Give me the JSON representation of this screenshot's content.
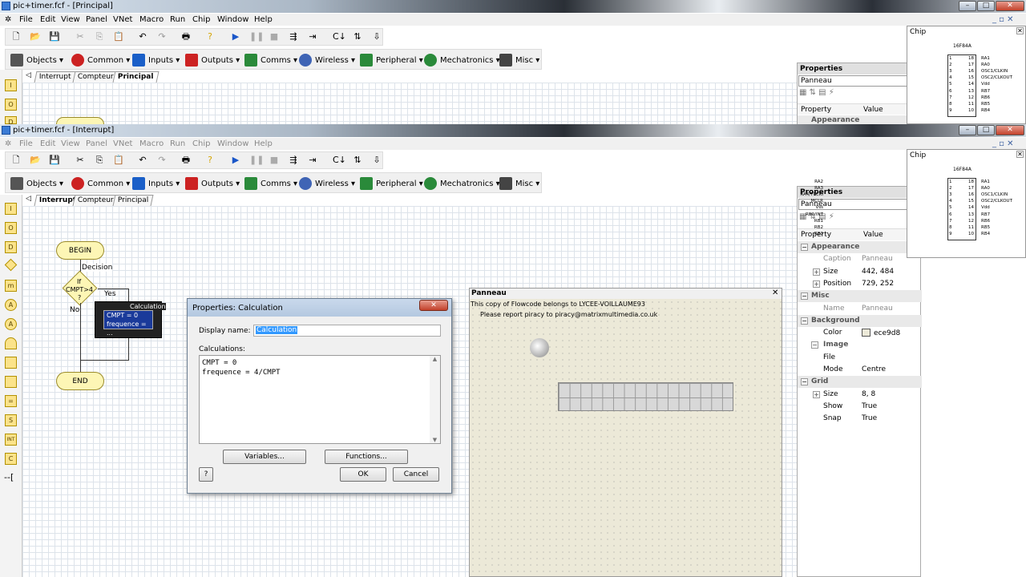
{
  "windows": [
    {
      "title": "pic+timer.fcf - [Principal]",
      "tabs": [
        "Interrupt",
        "Compteur",
        "Principal"
      ],
      "active_tab": "Principal"
    },
    {
      "title": "pic+timer.fcf - [Interrupt]",
      "tabs": [
        "Interrupt",
        "Compteur",
        "Principal"
      ],
      "active_tab": "Interrupt"
    }
  ],
  "menu": [
    "File",
    "Edit",
    "View",
    "Panel",
    "VNet",
    "Macro",
    "Run",
    "Chip",
    "Window",
    "Help"
  ],
  "component_toolbar": [
    "Objects",
    "Common",
    "Inputs",
    "Outputs",
    "Comms",
    "Wireless",
    "Peripheral",
    "Mechatronics",
    "Misc"
  ],
  "chip_panel": {
    "title": "Chip",
    "chip_name": "16F84A",
    "left_pins": [
      "RA2",
      "RA3",
      "RA4/T0CKI",
      "MCLR",
      "Vss",
      "RB0/INT",
      "RB1",
      "RB2",
      "RB3"
    ],
    "right_pins": [
      "RA1",
      "RA0",
      "OSC1/CLKIN",
      "OSC2/CLKOUT",
      "Vdd",
      "RB7",
      "RB6",
      "RB5",
      "RB4"
    ]
  },
  "properties": {
    "title": "Properties",
    "selected": "Panneau",
    "col_property": "Property",
    "col_value": "Value",
    "top_category": "Appearance",
    "rows": [
      {
        "type": "cat",
        "key": "Appearance"
      },
      {
        "type": "row",
        "key": "Caption",
        "value": "Panneau",
        "dim": true
      },
      {
        "type": "exp",
        "key": "Size",
        "value": "442, 484"
      },
      {
        "type": "exp",
        "key": "Position",
        "value": "729, 252"
      },
      {
        "type": "cat",
        "key": "Misc"
      },
      {
        "type": "row",
        "key": "Name",
        "value": "Panneau",
        "dim": true
      },
      {
        "type": "cat",
        "key": "Background"
      },
      {
        "type": "row",
        "key": "Color",
        "value": "ece9d8",
        "swatch": "#ece9d8"
      },
      {
        "type": "subcat",
        "key": "Image"
      },
      {
        "type": "row",
        "key": "File",
        "value": ""
      },
      {
        "type": "row",
        "key": "Mode",
        "value": "Centre"
      },
      {
        "type": "cat",
        "key": "Grid"
      },
      {
        "type": "exp",
        "key": "Size",
        "value": "8, 8"
      },
      {
        "type": "row",
        "key": "Show",
        "value": "True"
      },
      {
        "type": "row",
        "key": "Snap",
        "value": "True"
      }
    ]
  },
  "flowchart": {
    "begin": "BEGIN",
    "end": "END",
    "decision_label": "Decision",
    "decision_text_1": "If",
    "decision_text_2": "CMPT>4",
    "decision_text_3": "?",
    "yes": "Yes",
    "no": "No",
    "calc_label": "Calculation",
    "calc_line1": "CMPT = 0",
    "calc_line2": "frequence = ..."
  },
  "dialog": {
    "title": "Properties: Calculation",
    "display_name_label": "Display name:",
    "display_name_value": "Calculation",
    "calculations_label": "Calculations:",
    "code_line1": "CMPT = 0",
    "code_line2": "frequence = 4/CMPT",
    "variables_btn": "Variables...",
    "functions_btn": "Functions...",
    "help_btn": "?",
    "ok_btn": "OK",
    "cancel_btn": "Cancel"
  },
  "panneau": {
    "title": "Panneau",
    "line1": "This copy of Flowcode belongs to LYCEE-VOILLAUME93",
    "line2": "Please report piracy to piracy@matrixmultimedia.co.uk",
    "bg_color": "#ece9d8"
  }
}
